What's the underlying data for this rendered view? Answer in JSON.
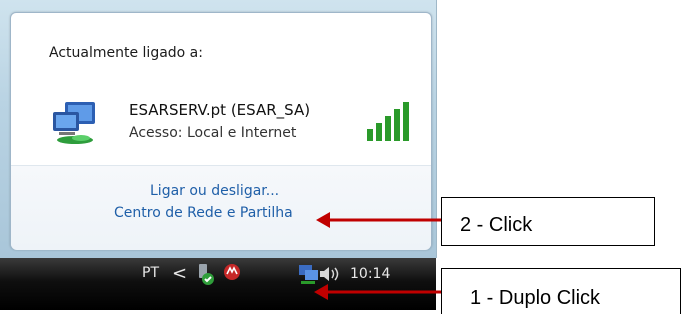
{
  "popup": {
    "title": "Actualmente ligado a:",
    "network": {
      "name": "ESARSERV.pt (ESAR_SA)",
      "access": "Acesso:  Local e Internet",
      "icon": "network-computers-icon",
      "signal_icon": "signal-strength-icon",
      "signal_bars": 5
    },
    "links": {
      "connect_disconnect": "Ligar ou desligar...",
      "network_center": "Centro de Rede e Partilha"
    }
  },
  "taskbar": {
    "language": "PT",
    "chevron": "<",
    "clock": "10:14",
    "tray_icons": [
      "safely-remove-hardware-icon",
      "antivirus-icon",
      "network-tray-icon",
      "volume-icon"
    ]
  },
  "annotations": {
    "step2": "2 - Click",
    "step1": "1 - Duplo Click",
    "arrow_color": "#c00000"
  },
  "colors": {
    "link": "#1f5fa8",
    "signal_green": "#2a9a2a",
    "taskbar": "#000000"
  }
}
